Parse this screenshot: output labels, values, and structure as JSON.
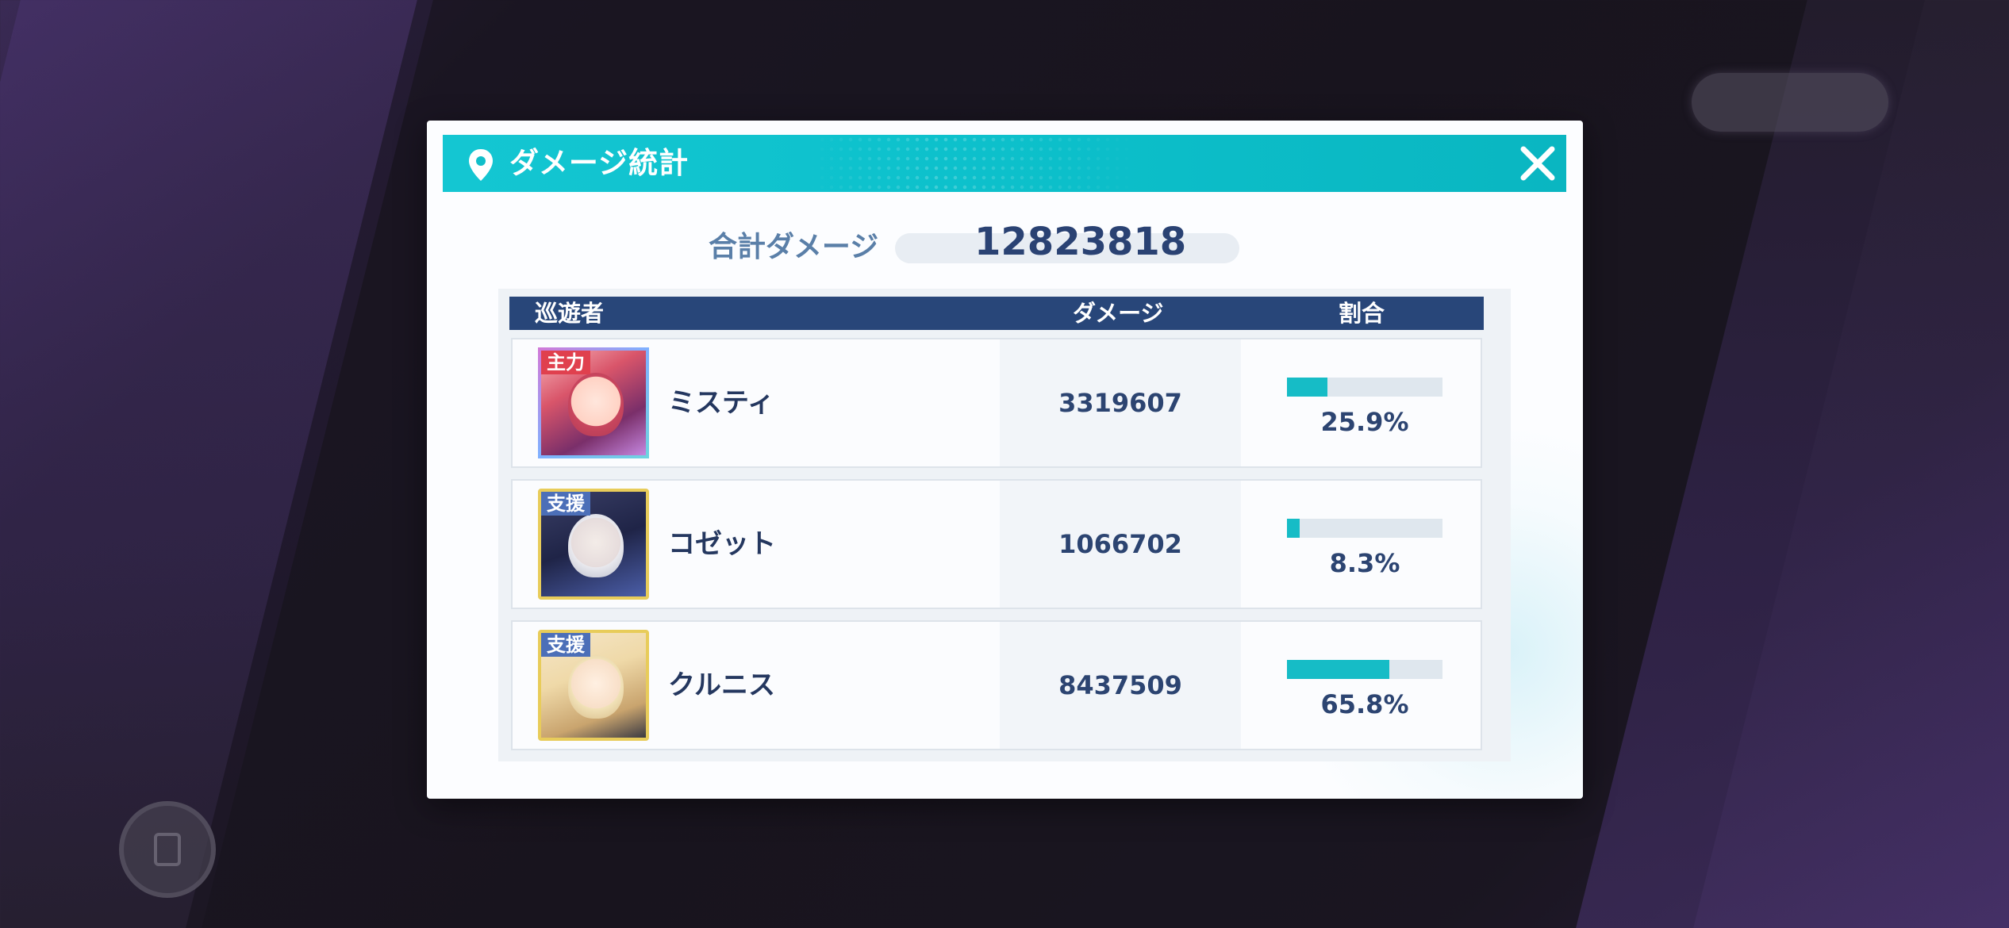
{
  "dialog": {
    "title": "ダメージ統計",
    "total_label": "合計ダメージ",
    "total_value": "12823818"
  },
  "table": {
    "headers": {
      "name": "巡遊者",
      "damage": "ダメージ",
      "ratio": "割合"
    },
    "rows": [
      {
        "role_tag": "主力",
        "name": "ミスティ",
        "damage": "3319607",
        "ratio_label": "25.9%",
        "ratio": 0.259
      },
      {
        "role_tag": "支援",
        "name": "コゼット",
        "damage": "1066702",
        "ratio_label": "8.3%",
        "ratio": 0.083
      },
      {
        "role_tag": "支援",
        "name": "クルニス",
        "damage": "8437509",
        "ratio_label": "65.8%",
        "ratio": 0.658
      }
    ]
  },
  "colors": {
    "title_bar": "#0dc1cc",
    "table_header": "#284679",
    "bar_fill": "#16bcc6",
    "tag_main": "#e0404e",
    "tag_support": "#4c6fb8"
  },
  "icons": {
    "title": "location-pin-icon",
    "close": "close-icon"
  }
}
